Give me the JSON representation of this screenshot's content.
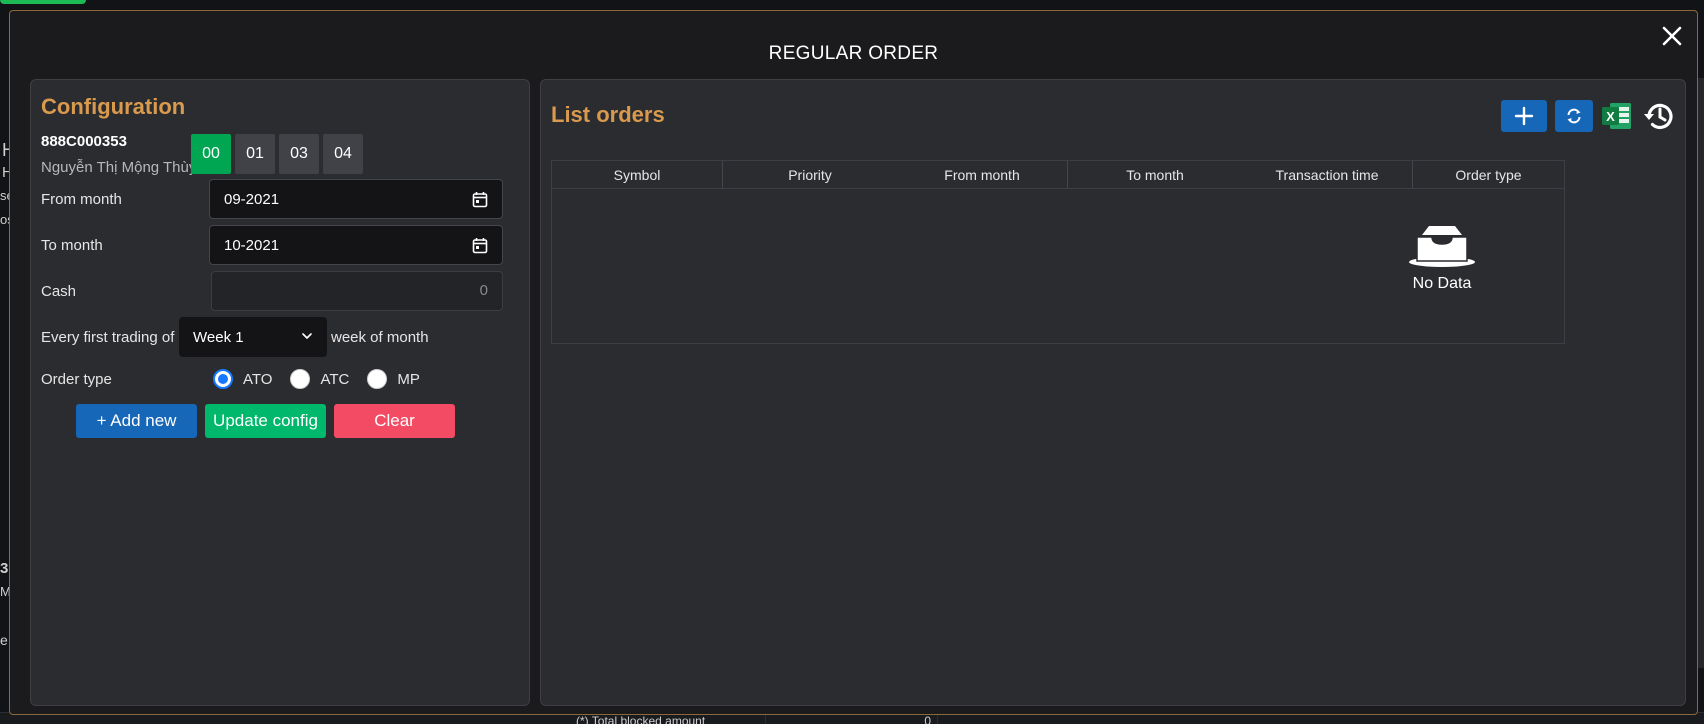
{
  "modal": {
    "title": "REGULAR ORDER"
  },
  "configuration": {
    "heading": "Configuration",
    "account_id": "888C000353",
    "account_name": "Nguyễn Thị Mộng Thùy",
    "sub_accounts": [
      "00",
      "01",
      "03",
      "04"
    ],
    "active_sub_account": "00",
    "from_month_label": "From month",
    "from_month_value": "09-2021",
    "to_month_label": "To month",
    "to_month_value": "10-2021",
    "cash_label": "Cash",
    "cash_placeholder": "0",
    "every_label": "Every first trading of",
    "week_value": "Week 1",
    "week_suffix": "week of month",
    "order_type_label": "Order type",
    "order_types": [
      "ATO",
      "ATC",
      "MP"
    ],
    "selected_order_type": "ATO",
    "add_label": "+ Add new",
    "update_label": "Update config",
    "clear_label": "Clear"
  },
  "list_orders": {
    "heading": "List orders",
    "columns": [
      "Symbol",
      "Priority",
      "From month",
      "To month",
      "Transaction time",
      "Order type"
    ],
    "empty_text": "No Data"
  },
  "background": {
    "bottom_text": "(*) Total blocked amount",
    "bottom_value": "0"
  },
  "colors": {
    "accent_heading": "#d99a4e",
    "primary": "#1667b7",
    "success": "#00b86b",
    "active_tab": "#00a651",
    "danger": "#f24b63"
  }
}
